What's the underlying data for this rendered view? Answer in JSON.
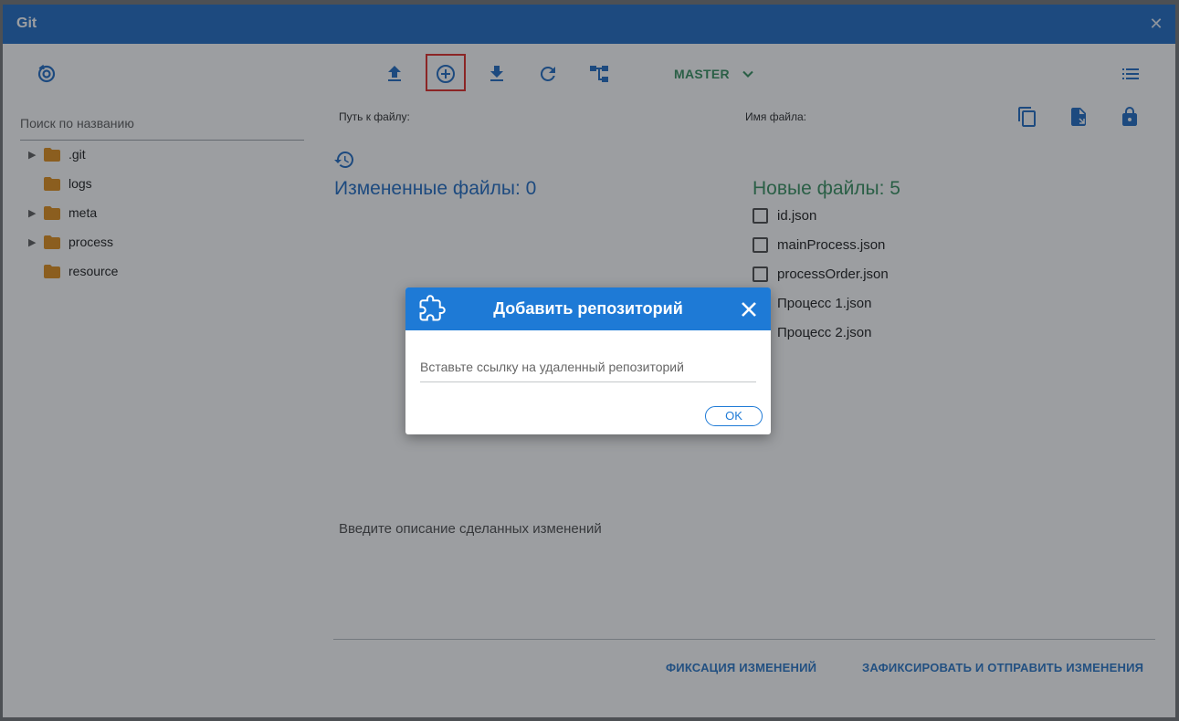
{
  "window": {
    "title": "Git"
  },
  "toolbar": {
    "branch": "MASTER"
  },
  "sidebar": {
    "search_placeholder": "Поиск по названию",
    "tree": [
      {
        "name": ".git",
        "expandable": true
      },
      {
        "name": "logs",
        "expandable": false
      },
      {
        "name": "meta",
        "expandable": true
      },
      {
        "name": "process",
        "expandable": true
      },
      {
        "name": "resource",
        "expandable": false
      }
    ]
  },
  "main": {
    "path_label": "Путь к файлу:",
    "filename_label": "Имя файла:",
    "changed_title": "Измененные файлы: 0",
    "new_title": "Новые файлы: 5",
    "new_files": [
      "id.json",
      "mainProcess.json",
      "processOrder.json",
      "Процесс 1.json",
      "Процесс 2.json"
    ],
    "description_placeholder": "Введите описание сделанных изменений",
    "commit_button": "ФИКСАЦИЯ ИЗМЕНЕНИЙ",
    "commit_push_button": "ЗАФИКСИРОВАТЬ И ОТПРАВИТЬ ИЗМЕНЕНИЯ"
  },
  "dialog": {
    "title": "Добавить репозиторий",
    "url_placeholder": "Вставьте ссылку на удаленный репозиторий",
    "ok_label": "OK"
  },
  "colors": {
    "header_blue": "#1565c0",
    "dialog_blue": "#1e7ad6",
    "green": "#2e8b57",
    "folder": "#e08a0f",
    "highlight_red": "#e0201a"
  },
  "icons": [
    "settings-spiral-icon",
    "upload-icon",
    "add-circle-icon",
    "download-icon",
    "refresh-icon",
    "branch-tree-icon",
    "chevron-down-icon",
    "list-menu-icon",
    "copy-icon",
    "file-move-icon",
    "lock-icon",
    "history-icon",
    "puzzle-icon",
    "close-icon",
    "folder-icon"
  ]
}
